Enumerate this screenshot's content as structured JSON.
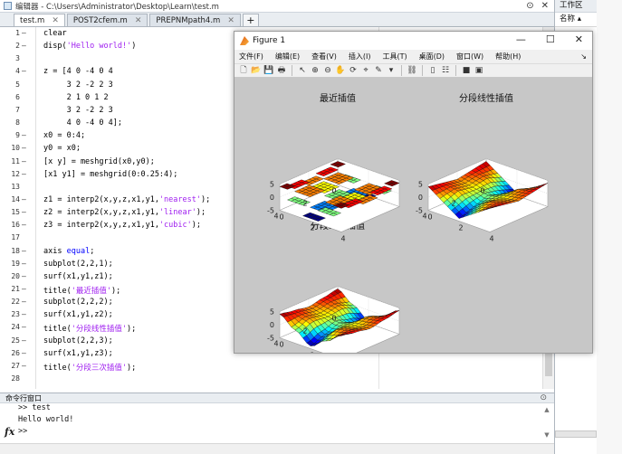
{
  "editor": {
    "title": "编辑器 - C:\\Users\\Administrator\\Desktop\\Learn\\test.m",
    "tabs": [
      {
        "label": "test.m",
        "active": true
      },
      {
        "label": "POST2cfem.m",
        "active": false
      },
      {
        "label": "PREPNMpath4.m",
        "active": false
      }
    ],
    "add_tab": "+",
    "lines": [
      {
        "n": "1",
        "d": "—",
        "code": "clear"
      },
      {
        "n": "2",
        "d": "—",
        "code": "disp('Hello world!')"
      },
      {
        "n": "3",
        "d": "",
        "code": ""
      },
      {
        "n": "4",
        "d": "—",
        "code": "z = [4 0 -4 0 4"
      },
      {
        "n": "5",
        "d": "",
        "code": "     3 2 -2 2 3"
      },
      {
        "n": "6",
        "d": "",
        "code": "     2 1 0 1 2"
      },
      {
        "n": "7",
        "d": "",
        "code": "     3 2 -2 2 3"
      },
      {
        "n": "8",
        "d": "",
        "code": "     4 0 -4 0 4];"
      },
      {
        "n": "9",
        "d": "—",
        "code": "x0 = 0:4;"
      },
      {
        "n": "10",
        "d": "—",
        "code": "y0 = x0;"
      },
      {
        "n": "11",
        "d": "—",
        "code": "[x y] = meshgrid(x0,y0);"
      },
      {
        "n": "12",
        "d": "—",
        "code": "[x1 y1] = meshgrid(0:0.25:4);"
      },
      {
        "n": "13",
        "d": "",
        "code": ""
      },
      {
        "n": "14",
        "d": "—",
        "code": "z1 = interp2(x,y,z,x1,y1,'nearest');"
      },
      {
        "n": "15",
        "d": "—",
        "code": "z2 = interp2(x,y,z,x1,y1,'linear');"
      },
      {
        "n": "16",
        "d": "—",
        "code": "z3 = interp2(x,y,z,x1,y1,'cubic');"
      },
      {
        "n": "17",
        "d": "",
        "code": ""
      },
      {
        "n": "18",
        "d": "—",
        "code": "axis equal;"
      },
      {
        "n": "19",
        "d": "—",
        "code": "subplot(2,2,1);"
      },
      {
        "n": "20",
        "d": "—",
        "code": "surf(x1,y1,z1);"
      },
      {
        "n": "21",
        "d": "—",
        "code": "title('最近插值');"
      },
      {
        "n": "22",
        "d": "—",
        "code": "subplot(2,2,2);"
      },
      {
        "n": "23",
        "d": "—",
        "code": "surf(x1,y1,z2);"
      },
      {
        "n": "24",
        "d": "—",
        "code": "title('分段线性插值');"
      },
      {
        "n": "25",
        "d": "—",
        "code": "subplot(2,2,3);"
      },
      {
        "n": "26",
        "d": "—",
        "code": "surf(x1,y1,z3);"
      },
      {
        "n": "27",
        "d": "—",
        "code": "title('分段三次插值');"
      },
      {
        "n": "28",
        "d": "",
        "code": ""
      }
    ]
  },
  "command_window": {
    "title": "命令行窗口",
    "lines": [
      ">> test",
      "Hello world!",
      ">>"
    ],
    "prompt_icon": "fx"
  },
  "workspace": {
    "title": "工作区",
    "column": "名称 ▴"
  },
  "figure": {
    "title": "Figure 1",
    "menu": [
      "文件(F)",
      "编辑(E)",
      "查看(V)",
      "插入(I)",
      "工具(T)",
      "桌面(D)",
      "窗口(W)",
      "帮助(H)"
    ],
    "plots": [
      {
        "title": "最近插值",
        "method": "nearest"
      },
      {
        "title": "分段线性插值",
        "method": "linear"
      },
      {
        "title": "分段三次插值",
        "method": "cubic"
      }
    ],
    "z_ticks": [
      "5",
      "0",
      "-5"
    ],
    "x_ticks": [
      "0",
      "2",
      "4"
    ],
    "y_ticks": [
      "0",
      "2",
      "4"
    ]
  },
  "chart_data": [
    {
      "type": "surface",
      "title": "最近插值",
      "x": [
        0,
        1,
        2,
        3,
        4
      ],
      "y": [
        0,
        1,
        2,
        3,
        4
      ],
      "z": [
        [
          4,
          0,
          -4,
          0,
          4
        ],
        [
          3,
          2,
          -2,
          2,
          3
        ],
        [
          2,
          1,
          0,
          1,
          2
        ],
        [
          3,
          2,
          -2,
          2,
          3
        ],
        [
          4,
          0,
          -4,
          0,
          4
        ]
      ],
      "zlim": [
        -5,
        5
      ]
    },
    {
      "type": "surface",
      "title": "分段线性插值",
      "x": [
        0,
        1,
        2,
        3,
        4
      ],
      "y": [
        0,
        1,
        2,
        3,
        4
      ],
      "z": [
        [
          4,
          0,
          -4,
          0,
          4
        ],
        [
          3,
          2,
          -2,
          2,
          3
        ],
        [
          2,
          1,
          0,
          1,
          2
        ],
        [
          3,
          2,
          -2,
          2,
          3
        ],
        [
          4,
          0,
          -4,
          0,
          4
        ]
      ],
      "zlim": [
        -5,
        5
      ]
    },
    {
      "type": "surface",
      "title": "分段三次插值",
      "x": [
        0,
        1,
        2,
        3,
        4
      ],
      "y": [
        0,
        1,
        2,
        3,
        4
      ],
      "z": [
        [
          4,
          0,
          -4,
          0,
          4
        ],
        [
          3,
          2,
          -2,
          2,
          3
        ],
        [
          2,
          1,
          0,
          1,
          2
        ],
        [
          3,
          2,
          -2,
          2,
          3
        ],
        [
          4,
          0,
          -4,
          0,
          4
        ]
      ],
      "zlim": [
        -5,
        5
      ]
    }
  ]
}
